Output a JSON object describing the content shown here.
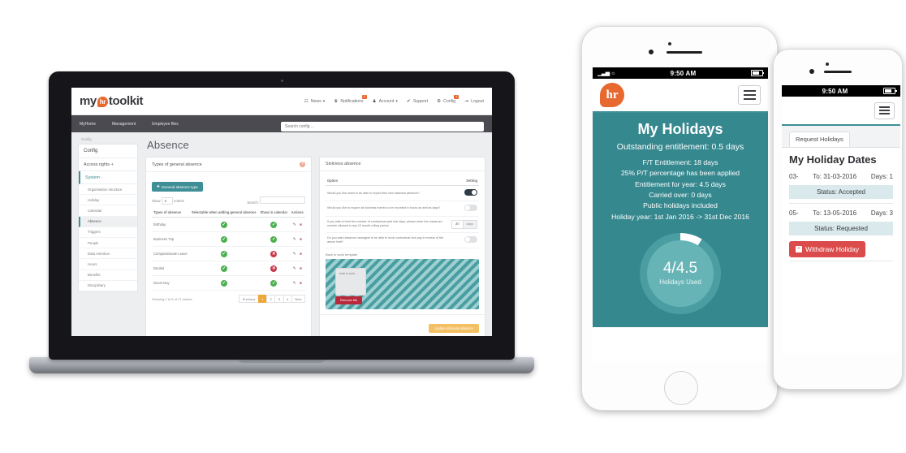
{
  "desktop": {
    "brand": {
      "pre": "my",
      "mark": "hr",
      "post": "toolkit"
    },
    "topnav": [
      {
        "label": "News",
        "icon": "news-icon",
        "glyph": "☷",
        "caret": "▾",
        "badge": ""
      },
      {
        "label": "Notifications",
        "icon": "bell-icon",
        "glyph": "♛",
        "caret": "",
        "badge": "0"
      },
      {
        "label": "Account",
        "icon": "user-icon",
        "glyph": "♟",
        "caret": "▾",
        "badge": ""
      },
      {
        "label": "Support",
        "icon": "help-icon",
        "glyph": "✔",
        "caret": "",
        "badge": ""
      },
      {
        "label": "Config",
        "icon": "gear-icon",
        "glyph": "⚙",
        "caret": "",
        "badge": "1"
      },
      {
        "label": "Logout",
        "icon": "logout-icon",
        "glyph": "⇥",
        "caret": "",
        "badge": ""
      }
    ],
    "subnav": [
      "MyHome",
      "Management",
      "Employee files"
    ],
    "search": {
      "placeholder": "Search config ...",
      "value": ""
    },
    "breadcrumb": "Config",
    "sidebar": {
      "header": "Config",
      "groups": [
        {
          "label": "Access rights",
          "caret": "+"
        },
        {
          "label": "System",
          "caret": "-"
        }
      ],
      "items": [
        "Organisation structure",
        "Holiday",
        "Calendar",
        "Absence",
        "Triggers",
        "People",
        "Data retention",
        "Hours",
        "Benefits",
        "Disciplinary"
      ],
      "active": "Absence"
    },
    "page_title": "Absence",
    "general_panel": {
      "title": "Types of general absence",
      "help_glyph": "?",
      "add_button": "General absence type",
      "add_icon": "plus-circle-icon",
      "show_label": "Show",
      "entries_label": "entries",
      "page_size": "5",
      "search_label": "Search:",
      "search_value": "",
      "columns": [
        "Types of absence",
        "Selectable when adding general absence",
        "Show in calendar",
        "Actions"
      ],
      "rows": [
        {
          "name": "Birthday",
          "selectable": true,
          "calendar": true
        },
        {
          "name": "Business Trip",
          "selectable": true,
          "calendar": true
        },
        {
          "name": "Compassionate Leave",
          "selectable": true,
          "calendar": false
        },
        {
          "name": "Dentist",
          "selectable": true,
          "calendar": false
        },
        {
          "name": "Duvet Day",
          "selectable": true,
          "calendar": true
        }
      ],
      "tick_glyph": "✓",
      "cross_glyph": "✕",
      "edit_icon": "pencil-icon",
      "edit_glyph": "✎",
      "delete_icon": "trash-icon",
      "delete_glyph": "Ὕ1",
      "footer_info": "Showing 1 to 5 of 17 entries",
      "pagination": {
        "prev": "Previous",
        "pages": [
          "1",
          "2",
          "3",
          "4"
        ],
        "next": "Next",
        "current": "1"
      }
    },
    "sickness_panel": {
      "title": "Sickness absence",
      "col_option": "Option",
      "col_setting": "Setting",
      "options": [
        {
          "text": "Would you like users to be able to report their own sickness absence?",
          "type": "toggle",
          "on": true
        },
        {
          "text": "Would you like to require all sickness events to be recorded in hours as well as days?",
          "type": "toggle",
          "on": false
        },
        {
          "text": "If you wish to limit the number of contractual paid sick days, please enter the maximum number allowed in any 12 month rolling period.",
          "type": "number",
          "value": "30",
          "unit": "days"
        },
        {
          "text": "Do you want absence managers to be able to book contractual sick pay in excess of the above limit?",
          "type": "toggle",
          "on": false
        }
      ],
      "template_label": "Back to work template",
      "file_name": "back to work ...",
      "remove_button": "Remove file",
      "remove_icon": "remove-file-icon",
      "update_button": "Update sickness absence"
    }
  },
  "phone1": {
    "status": {
      "time": "9:50 AM",
      "signal": "▪▪▪▫▫",
      "wifi_icon": "wifi-icon",
      "battery_icon": "battery-icon"
    },
    "logo_icon": "hr-bubble-logo",
    "logo_text": "hr",
    "menu_icon": "hamburger-menu-icon",
    "title": "My Holidays",
    "subtitle": "Outstanding entitlement: 0.5 days",
    "details": [
      "F/T Entitlement: 18 days",
      "25% P/T percentage has been applied",
      "Entitlement for year: 4.5 days",
      "Carried over: 0 days",
      "Public holidays included",
      "Holiday year: 1st Jan 2016 -> 31st Dec 2016"
    ],
    "donut": {
      "value": "4/4.5",
      "label": "Holidays Used",
      "used": 4,
      "total": 4.5
    }
  },
  "phone2": {
    "status": {
      "time": "9:50 AM",
      "battery_icon": "battery-icon"
    },
    "menu_icon": "hamburger-menu-icon",
    "tab": "Request Holidays",
    "title": "My Holiday Dates",
    "bookings": [
      {
        "from": "03-",
        "to": "To: 31-03-2016",
        "days": "Days: 1",
        "status": "Status: Accepted",
        "withdraw": false
      },
      {
        "from": "05-",
        "to": "To: 13-05-2016",
        "days": "Days: 3",
        "status": "Status: Requested",
        "withdraw": true
      }
    ],
    "withdraw_button": "Withdraw Holiday",
    "withdraw_icon": "minus-square-icon"
  },
  "colors": {
    "teal": "#36888F",
    "teal_light": "#67B4B6",
    "orange": "#E8692F",
    "amber": "#F3C063",
    "red": "#DC4B4B",
    "green": "#4CB050",
    "dark": "#4A4A50"
  }
}
